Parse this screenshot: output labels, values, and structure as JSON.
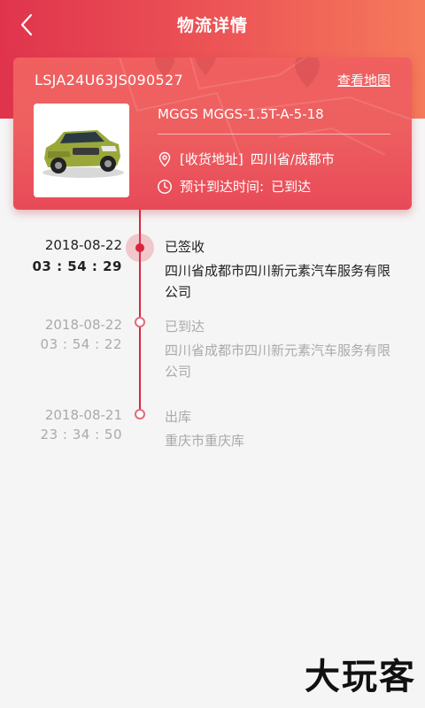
{
  "header": {
    "title": "物流详情",
    "back_icon": "back-chevron-icon"
  },
  "vehicle": {
    "vin": "LSJA24U63JS090527",
    "map_link": "查看地图",
    "model": "MGGS MGGS-1.5T-A-5-18",
    "address_label": "[收货地址]",
    "address_value": "四川省/成都市",
    "eta_label": "预计到达时间:",
    "eta_value": "已到达",
    "thumbnail": "suv-car-photo"
  },
  "timeline": [
    {
      "date": "2018-08-22",
      "time": "03 : 54 : 29",
      "status": "已签收",
      "place": "四川省成都市四川新元素汽车服务有限公司",
      "state": "active"
    },
    {
      "date": "2018-08-22",
      "time": "03 : 54 : 22",
      "status": "已到达",
      "place": "四川省成都市四川新元素汽车服务有限公司",
      "state": "past"
    },
    {
      "date": "2018-08-21",
      "time": "23 : 34 : 50",
      "status": "出库",
      "place": "重庆市重庆库",
      "state": "past"
    }
  ],
  "watermark": "大玩客",
  "colors": {
    "accent": "#d9253c",
    "header_gradient_start": "#e0344d",
    "header_gradient_end": "#f57a5b",
    "card": "#ee6060",
    "muted_text": "#aaaaaa"
  }
}
